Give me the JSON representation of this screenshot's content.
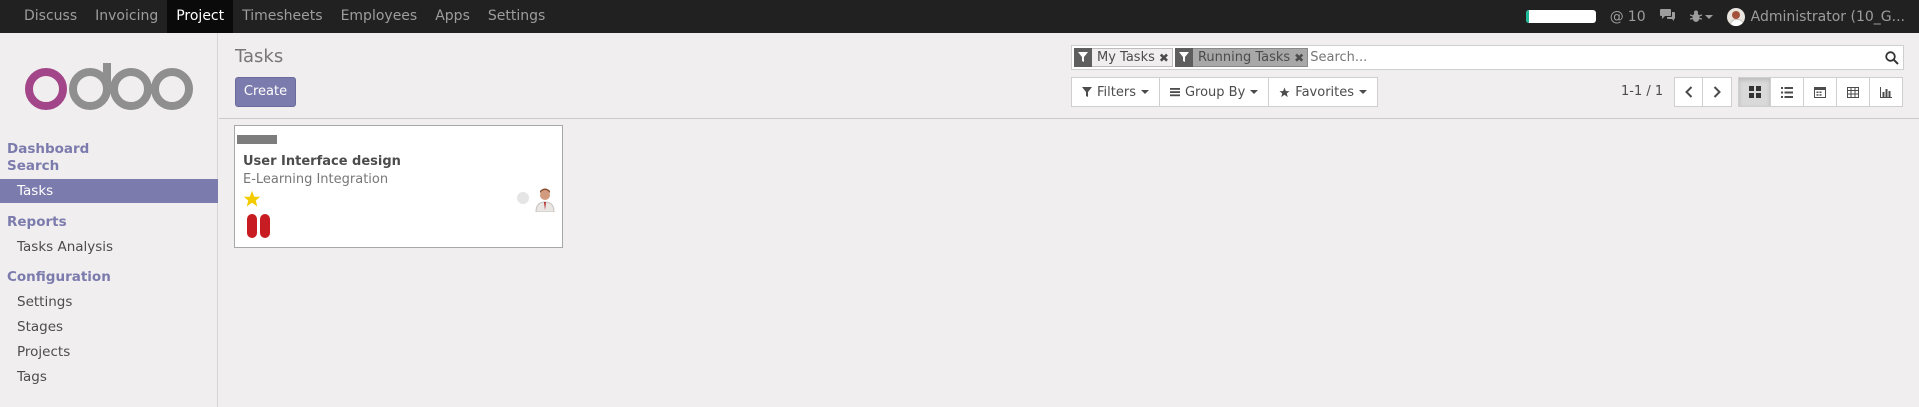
{
  "topbar": {
    "menu": [
      "Discuss",
      "Invoicing",
      "Project",
      "Timesheets",
      "Employees",
      "Apps",
      "Settings"
    ],
    "active": "Project",
    "progress_value": 0.05,
    "mentions_count": "10",
    "user": "Administrator (10_G..."
  },
  "sidebar": {
    "logo_text": "odoo",
    "sections": [
      {
        "header": "Dashboard",
        "items": []
      },
      {
        "header": "Search",
        "items": [
          "Tasks"
        ]
      },
      {
        "header": "Reports",
        "items": [
          "Tasks Analysis"
        ]
      },
      {
        "header": "Configuration",
        "items": [
          "Settings",
          "Stages",
          "Projects",
          "Tags"
        ]
      }
    ],
    "active_item": "Tasks"
  },
  "control": {
    "title": "Tasks",
    "create_label": "Create",
    "facets": [
      "My Tasks",
      "Running Tasks"
    ],
    "search_placeholder": "Search...",
    "filters_label": "Filters",
    "groupby_label": "Group By",
    "favorites_label": "Favorites",
    "pager_text": "1-1 / 1"
  },
  "card": {
    "title": "User Interface design",
    "project": "E-Learning Integration",
    "priority": "starred",
    "kanban_state": "blocked"
  },
  "colors": {
    "brand": "#7c7bad",
    "navbar": "#212121",
    "blocked": "#c71c22",
    "star": "#f3cc00"
  }
}
